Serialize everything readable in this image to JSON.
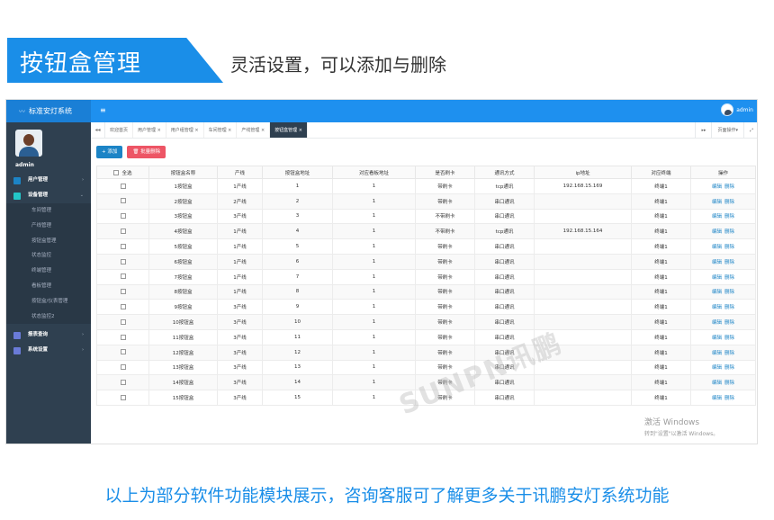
{
  "banner": {
    "title": "按钮盒管理",
    "subtitle": "灵活设置，可以添加与删除"
  },
  "app": {
    "brand": "标准安灯系统",
    "menu_toggle": "≡",
    "user": "admin"
  },
  "sidebar": {
    "username": "admin",
    "items": [
      {
        "label": "用户管理",
        "type": "top",
        "icon_color": "#1c84c6"
      },
      {
        "label": "设备管理",
        "type": "top",
        "icon_color": "#23c6c8",
        "expanded": true
      },
      {
        "label": "车间管理",
        "type": "sub"
      },
      {
        "label": "产线管理",
        "type": "sub"
      },
      {
        "label": "按钮盒管理",
        "type": "sub"
      },
      {
        "label": "状态监控",
        "type": "sub"
      },
      {
        "label": "终端管理",
        "type": "sub"
      },
      {
        "label": "看板管理",
        "type": "sub"
      },
      {
        "label": "按钮盒/仪表管理",
        "type": "sub"
      },
      {
        "label": "状态监控2",
        "type": "sub"
      },
      {
        "label": "报表查询",
        "type": "top",
        "icon_color": "#6a7bd8"
      },
      {
        "label": "系统设置",
        "type": "top",
        "icon_color": "#6a7bd8"
      }
    ]
  },
  "tabs": {
    "back": "◂◂",
    "items": [
      "欢迎首页",
      "用户管理 ×",
      "用户组管理 ×",
      "车间管理 ×",
      "产线管理 ×",
      "按钮盒管理 ×"
    ],
    "active_index": 5,
    "forward": "▸▸",
    "page_ops": "页面操作▾",
    "fullscreen": "⤢"
  },
  "toolbar": {
    "add": "+ 添加",
    "batch_delete": "🗑 批量删除"
  },
  "table": {
    "headers": [
      "全选",
      "按钮盒名称",
      "产线",
      "按钮盒地址",
      "对应看板地址",
      "是否刷卡",
      "通讯方式",
      "ip地址",
      "对应终端",
      "操作"
    ],
    "action_edit": "编辑",
    "action_delete": "删除",
    "rows": [
      [
        "1按钮盒",
        "1产线",
        "1",
        "1",
        "带刷卡",
        "tcp通讯",
        "192.168.15.169",
        "终端1"
      ],
      [
        "2按钮盒",
        "2产线",
        "2",
        "1",
        "带刷卡",
        "串口通讯",
        "",
        "终端1"
      ],
      [
        "3按钮盒",
        "3产线",
        "3",
        "1",
        "不带刷卡",
        "串口通讯",
        "",
        "终端1"
      ],
      [
        "4按钮盒",
        "1产线",
        "4",
        "1",
        "不带刷卡",
        "tcp通讯",
        "192.168.15.164",
        "终端1"
      ],
      [
        "5按钮盒",
        "1产线",
        "5",
        "1",
        "带刷卡",
        "串口通讯",
        "",
        "终端1"
      ],
      [
        "6按钮盒",
        "1产线",
        "6",
        "1",
        "带刷卡",
        "串口通讯",
        "",
        "终端1"
      ],
      [
        "7按钮盒",
        "1产线",
        "7",
        "1",
        "带刷卡",
        "串口通讯",
        "",
        "终端1"
      ],
      [
        "8按钮盒",
        "1产线",
        "8",
        "1",
        "带刷卡",
        "串口通讯",
        "",
        "终端1"
      ],
      [
        "9按钮盒",
        "3产线",
        "9",
        "1",
        "带刷卡",
        "串口通讯",
        "",
        "终端1"
      ],
      [
        "10按钮盒",
        "3产线",
        "10",
        "1",
        "带刷卡",
        "串口通讯",
        "",
        "终端1"
      ],
      [
        "11按钮盒",
        "3产线",
        "11",
        "1",
        "带刷卡",
        "串口通讯",
        "",
        "终端1"
      ],
      [
        "12按钮盒",
        "3产线",
        "12",
        "1",
        "带刷卡",
        "串口通讯",
        "",
        "终端1"
      ],
      [
        "13按钮盒",
        "3产线",
        "13",
        "1",
        "带刷卡",
        "串口通讯",
        "",
        "终端1"
      ],
      [
        "14按钮盒",
        "3产线",
        "14",
        "1",
        "带刷卡",
        "串口通讯",
        "",
        "终端1"
      ],
      [
        "15按钮盒",
        "3产线",
        "15",
        "1",
        "带刷卡",
        "串口通讯",
        "",
        "终端1"
      ]
    ]
  },
  "watermark": "SUNPN讯鹏",
  "windows_activate": {
    "title": "激活 Windows",
    "hint": "转到\"设置\"以激活 Windows。"
  },
  "footer": "以上为部分软件功能模块展示，咨询客服可了解更多关于讯鹏安灯系统功能",
  "colors": {
    "accent": "#1e90ef",
    "sidebar": "#2f4050",
    "danger": "#ed5565",
    "link": "#1c84c6"
  }
}
